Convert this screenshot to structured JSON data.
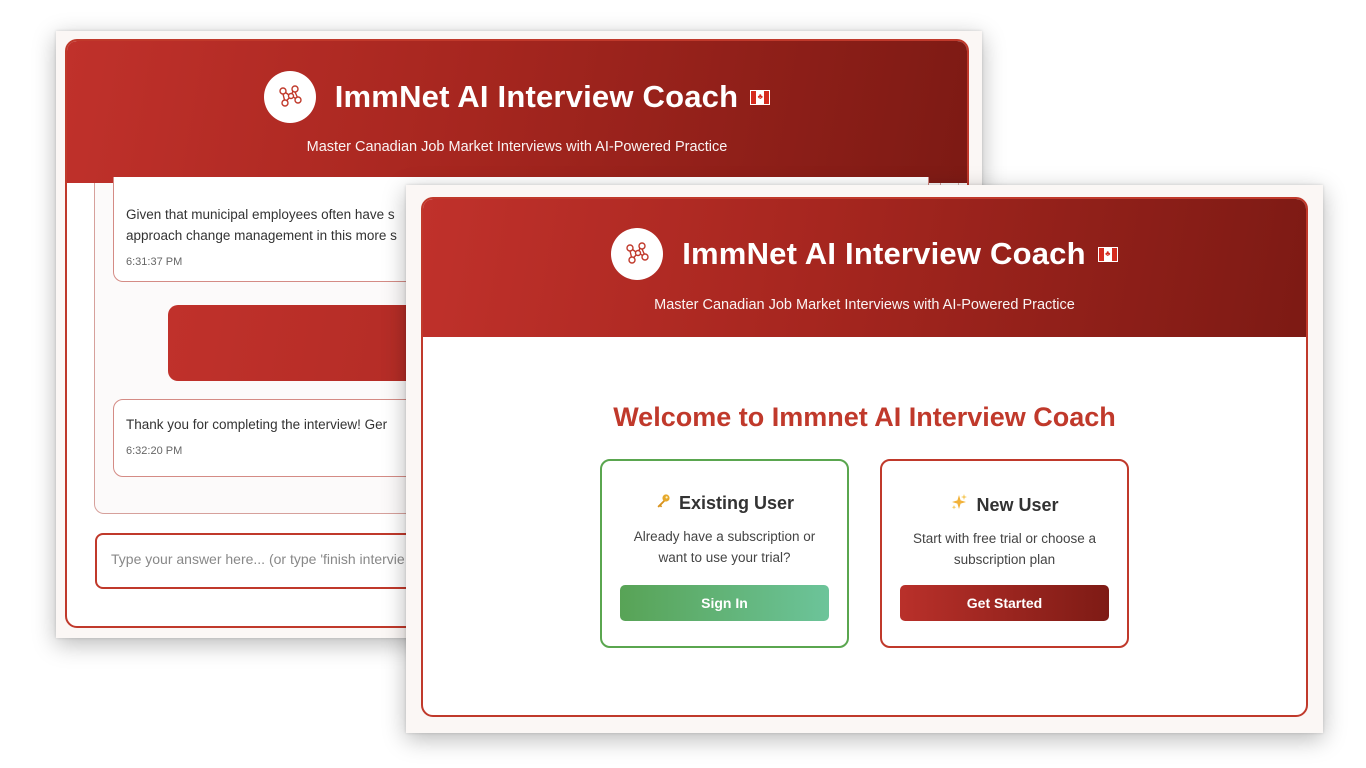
{
  "app": {
    "title": "ImmNet AI Interview Coach",
    "subtitle": "Master Canadian Job Market Interviews with AI-Powered Practice",
    "brand_color": "#c0392b"
  },
  "back_window": {
    "messages": [
      {
        "text": "Given that municipal employees often have s",
        "text2": "approach change management in this more s",
        "timestamp": "6:31:37 PM"
      },
      {
        "text": "Thank you for completing the interview! Ger",
        "timestamp": "6:32:20 PM"
      }
    ],
    "input_placeholder": "Type your answer here... (or type 'finish intervie"
  },
  "front_window": {
    "welcome_heading": "Welcome to Immnet AI Interview Coach",
    "cards": [
      {
        "icon": "key-icon",
        "title": "Existing User",
        "description": "Already have a subscription or want to use your trial?",
        "button_label": "Sign In",
        "accent": "#5aa64f"
      },
      {
        "icon": "sparkles-icon",
        "title": "New User",
        "description": "Start with free trial or choose a subscription plan",
        "button_label": "Get Started",
        "accent": "#c0392b"
      }
    ]
  }
}
